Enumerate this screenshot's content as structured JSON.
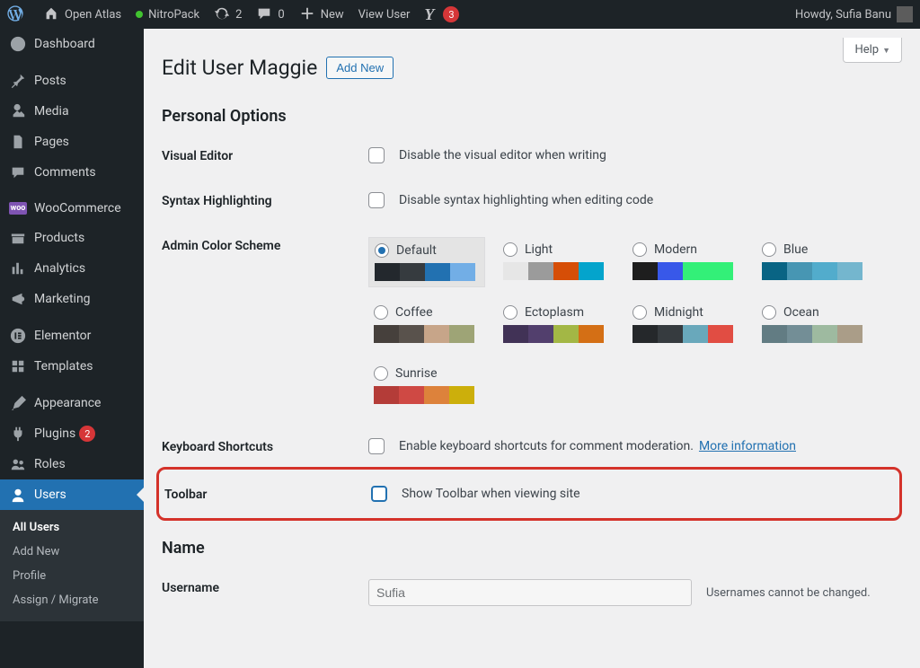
{
  "adminbar": {
    "site_name": "Open Atlas",
    "nitropack": "NitroPack",
    "refresh_count": "2",
    "comments_count": "0",
    "new_label": "New",
    "view_user": "View User",
    "yoast_count": "3",
    "howdy": "Howdy, Sufia Banu"
  },
  "sidebar": {
    "items": [
      {
        "id": "dashboard",
        "label": "Dashboard"
      },
      {
        "id": "posts",
        "label": "Posts"
      },
      {
        "id": "media",
        "label": "Media"
      },
      {
        "id": "pages",
        "label": "Pages"
      },
      {
        "id": "comments",
        "label": "Comments"
      },
      {
        "id": "woocommerce",
        "label": "WooCommerce"
      },
      {
        "id": "products",
        "label": "Products"
      },
      {
        "id": "analytics",
        "label": "Analytics"
      },
      {
        "id": "marketing",
        "label": "Marketing"
      },
      {
        "id": "elementor",
        "label": "Elementor"
      },
      {
        "id": "templates",
        "label": "Templates"
      },
      {
        "id": "appearance",
        "label": "Appearance"
      },
      {
        "id": "plugins",
        "label": "Plugins",
        "badge": "2"
      },
      {
        "id": "roles",
        "label": "Roles"
      },
      {
        "id": "users",
        "label": "Users"
      }
    ],
    "users_sub": {
      "all": "All Users",
      "add": "Add New",
      "profile": "Profile",
      "assign": "Assign / Migrate"
    }
  },
  "page": {
    "help": "Help",
    "title": "Edit User Maggie",
    "add_new": "Add New",
    "personal_options": "Personal Options",
    "visual_editor": {
      "label": "Visual Editor",
      "text": "Disable the visual editor when writing"
    },
    "syntax": {
      "label": "Syntax Highlighting",
      "text": "Disable syntax highlighting when editing code"
    },
    "color_scheme_label": "Admin Color Scheme",
    "schemes": {
      "default": "Default",
      "light": "Light",
      "modern": "Modern",
      "blue": "Blue",
      "coffee": "Coffee",
      "ectoplasm": "Ectoplasm",
      "midnight": "Midnight",
      "ocean": "Ocean",
      "sunrise": "Sunrise"
    },
    "keyboard": {
      "label": "Keyboard Shortcuts",
      "text": "Enable keyboard shortcuts for comment moderation. ",
      "link": "More information"
    },
    "toolbar": {
      "label": "Toolbar",
      "text": "Show Toolbar when viewing site"
    },
    "name_heading": "Name",
    "username": {
      "label": "Username",
      "value": "Sufia",
      "desc": "Usernames cannot be changed."
    }
  },
  "scheme_colors": {
    "default": [
      "#23282d",
      "#363b3f",
      "#2271b1",
      "#72aee6"
    ],
    "light": [
      "#e6e6e6",
      "#9b9b9b",
      "#d64e07",
      "#04a4cc"
    ],
    "modern": [
      "#1e1e1e",
      "#3858e9",
      "#33f078",
      "#33f078"
    ],
    "blue": [
      "#096484",
      "#4796b3",
      "#52accc",
      "#74b6ce"
    ],
    "coffee": [
      "#46403c",
      "#59524c",
      "#c7a589",
      "#9ea476"
    ],
    "ectoplasm": [
      "#413256",
      "#523f6d",
      "#a3b745",
      "#d46f15"
    ],
    "midnight": [
      "#25282b",
      "#363b3f",
      "#69a8bb",
      "#e14d43"
    ],
    "ocean": [
      "#627c83",
      "#738e96",
      "#9ebaa0",
      "#aa9d88"
    ],
    "sunrise": [
      "#b43c38",
      "#cf4944",
      "#dd823b",
      "#ccaf0b"
    ]
  }
}
